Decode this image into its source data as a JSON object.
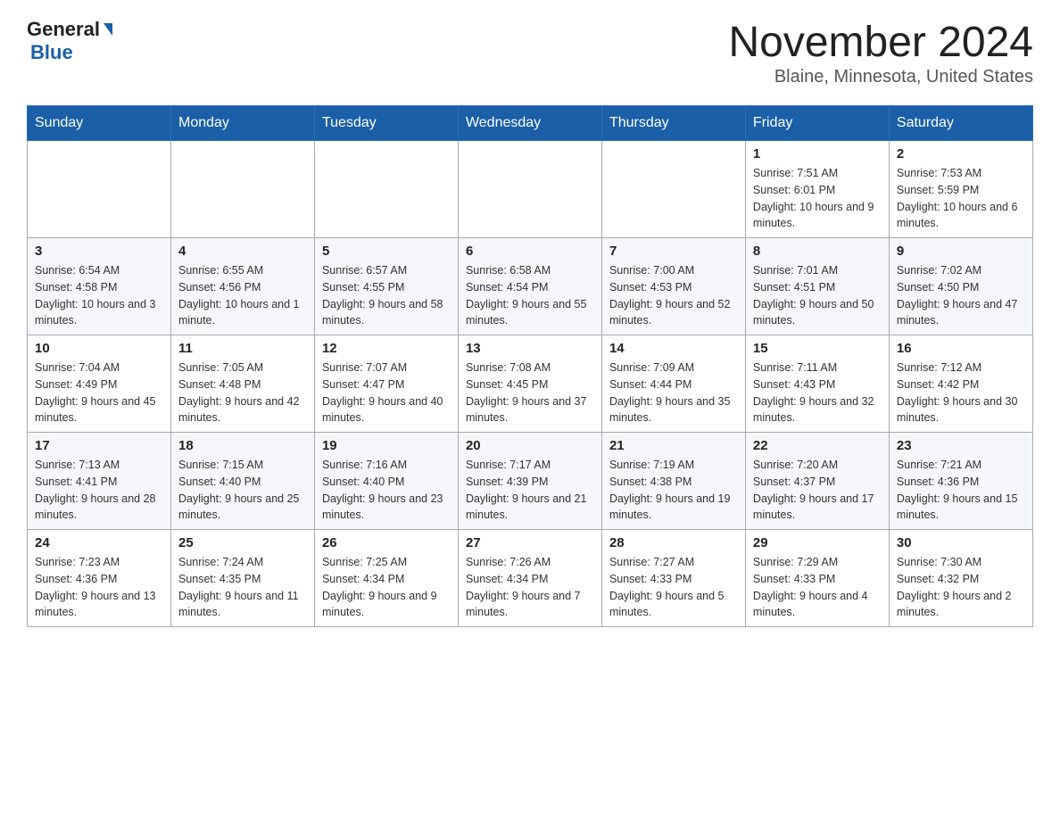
{
  "header": {
    "logo_general": "General",
    "logo_blue": "Blue",
    "month_title": "November 2024",
    "location": "Blaine, Minnesota, United States"
  },
  "days_of_week": [
    "Sunday",
    "Monday",
    "Tuesday",
    "Wednesday",
    "Thursday",
    "Friday",
    "Saturday"
  ],
  "weeks": [
    [
      {
        "day": "",
        "info": ""
      },
      {
        "day": "",
        "info": ""
      },
      {
        "day": "",
        "info": ""
      },
      {
        "day": "",
        "info": ""
      },
      {
        "day": "",
        "info": ""
      },
      {
        "day": "1",
        "info": "Sunrise: 7:51 AM\nSunset: 6:01 PM\nDaylight: 10 hours and 9 minutes."
      },
      {
        "day": "2",
        "info": "Sunrise: 7:53 AM\nSunset: 5:59 PM\nDaylight: 10 hours and 6 minutes."
      }
    ],
    [
      {
        "day": "3",
        "info": "Sunrise: 6:54 AM\nSunset: 4:58 PM\nDaylight: 10 hours and 3 minutes."
      },
      {
        "day": "4",
        "info": "Sunrise: 6:55 AM\nSunset: 4:56 PM\nDaylight: 10 hours and 1 minute."
      },
      {
        "day": "5",
        "info": "Sunrise: 6:57 AM\nSunset: 4:55 PM\nDaylight: 9 hours and 58 minutes."
      },
      {
        "day": "6",
        "info": "Sunrise: 6:58 AM\nSunset: 4:54 PM\nDaylight: 9 hours and 55 minutes."
      },
      {
        "day": "7",
        "info": "Sunrise: 7:00 AM\nSunset: 4:53 PM\nDaylight: 9 hours and 52 minutes."
      },
      {
        "day": "8",
        "info": "Sunrise: 7:01 AM\nSunset: 4:51 PM\nDaylight: 9 hours and 50 minutes."
      },
      {
        "day": "9",
        "info": "Sunrise: 7:02 AM\nSunset: 4:50 PM\nDaylight: 9 hours and 47 minutes."
      }
    ],
    [
      {
        "day": "10",
        "info": "Sunrise: 7:04 AM\nSunset: 4:49 PM\nDaylight: 9 hours and 45 minutes."
      },
      {
        "day": "11",
        "info": "Sunrise: 7:05 AM\nSunset: 4:48 PM\nDaylight: 9 hours and 42 minutes."
      },
      {
        "day": "12",
        "info": "Sunrise: 7:07 AM\nSunset: 4:47 PM\nDaylight: 9 hours and 40 minutes."
      },
      {
        "day": "13",
        "info": "Sunrise: 7:08 AM\nSunset: 4:45 PM\nDaylight: 9 hours and 37 minutes."
      },
      {
        "day": "14",
        "info": "Sunrise: 7:09 AM\nSunset: 4:44 PM\nDaylight: 9 hours and 35 minutes."
      },
      {
        "day": "15",
        "info": "Sunrise: 7:11 AM\nSunset: 4:43 PM\nDaylight: 9 hours and 32 minutes."
      },
      {
        "day": "16",
        "info": "Sunrise: 7:12 AM\nSunset: 4:42 PM\nDaylight: 9 hours and 30 minutes."
      }
    ],
    [
      {
        "day": "17",
        "info": "Sunrise: 7:13 AM\nSunset: 4:41 PM\nDaylight: 9 hours and 28 minutes."
      },
      {
        "day": "18",
        "info": "Sunrise: 7:15 AM\nSunset: 4:40 PM\nDaylight: 9 hours and 25 minutes."
      },
      {
        "day": "19",
        "info": "Sunrise: 7:16 AM\nSunset: 4:40 PM\nDaylight: 9 hours and 23 minutes."
      },
      {
        "day": "20",
        "info": "Sunrise: 7:17 AM\nSunset: 4:39 PM\nDaylight: 9 hours and 21 minutes."
      },
      {
        "day": "21",
        "info": "Sunrise: 7:19 AM\nSunset: 4:38 PM\nDaylight: 9 hours and 19 minutes."
      },
      {
        "day": "22",
        "info": "Sunrise: 7:20 AM\nSunset: 4:37 PM\nDaylight: 9 hours and 17 minutes."
      },
      {
        "day": "23",
        "info": "Sunrise: 7:21 AM\nSunset: 4:36 PM\nDaylight: 9 hours and 15 minutes."
      }
    ],
    [
      {
        "day": "24",
        "info": "Sunrise: 7:23 AM\nSunset: 4:36 PM\nDaylight: 9 hours and 13 minutes."
      },
      {
        "day": "25",
        "info": "Sunrise: 7:24 AM\nSunset: 4:35 PM\nDaylight: 9 hours and 11 minutes."
      },
      {
        "day": "26",
        "info": "Sunrise: 7:25 AM\nSunset: 4:34 PM\nDaylight: 9 hours and 9 minutes."
      },
      {
        "day": "27",
        "info": "Sunrise: 7:26 AM\nSunset: 4:34 PM\nDaylight: 9 hours and 7 minutes."
      },
      {
        "day": "28",
        "info": "Sunrise: 7:27 AM\nSunset: 4:33 PM\nDaylight: 9 hours and 5 minutes."
      },
      {
        "day": "29",
        "info": "Sunrise: 7:29 AM\nSunset: 4:33 PM\nDaylight: 9 hours and 4 minutes."
      },
      {
        "day": "30",
        "info": "Sunrise: 7:30 AM\nSunset: 4:32 PM\nDaylight: 9 hours and 2 minutes."
      }
    ]
  ]
}
